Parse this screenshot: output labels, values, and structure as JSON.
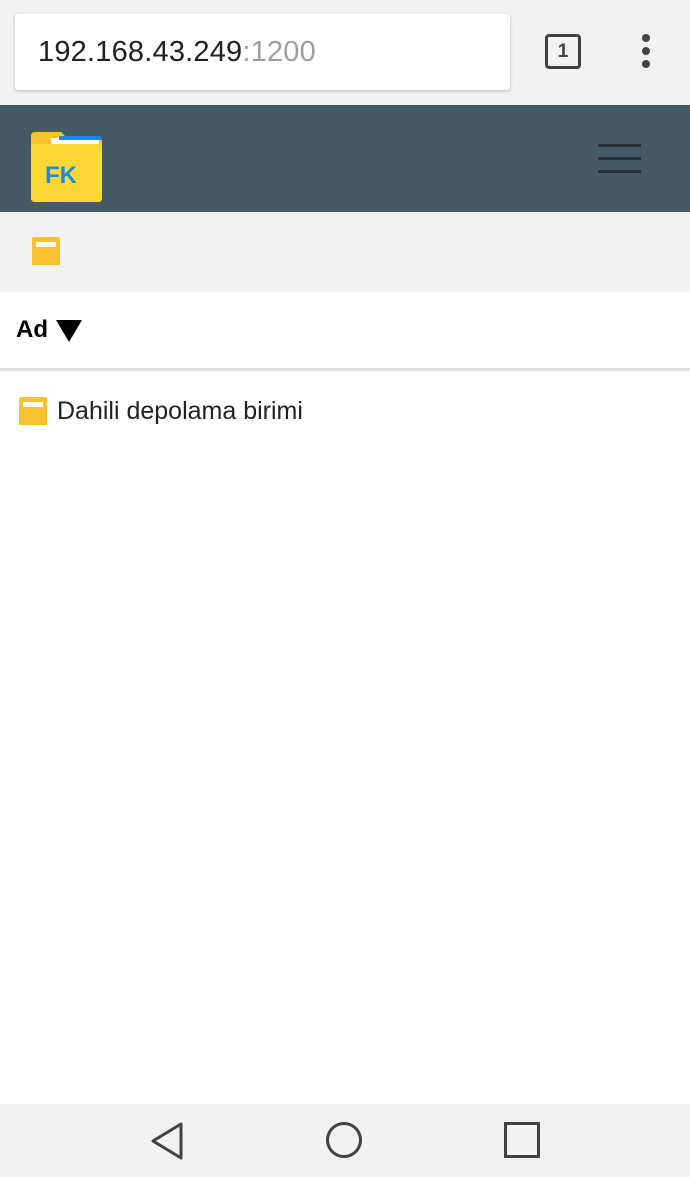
{
  "browser": {
    "url_host": "192.168.43.249",
    "url_port": ":1200",
    "tab_count": "1",
    "tabs_icon": "tab-switcher-icon",
    "menu_icon": "more-vert-icon"
  },
  "app": {
    "logo_text": "FK",
    "logo_icon": "folder-logo-icon",
    "menu_icon": "hamburger-menu-icon"
  },
  "breadcrumb": {
    "icon": "folder-icon"
  },
  "columns": {
    "name_label": "Ad",
    "sort_icon": "sort-descending-triangle-icon"
  },
  "items": [
    {
      "name": "Dahili depolama birimi",
      "icon": "folder-icon"
    }
  ],
  "nav": {
    "back_icon": "back-icon",
    "home_icon": "home-icon",
    "recents_icon": "recents-icon"
  },
  "colors": {
    "header_bg": "#455a64",
    "folder_yellow": "#fbc02d",
    "logo_blue": "#1e88e5",
    "chrome_bg": "#f2f2f2"
  }
}
